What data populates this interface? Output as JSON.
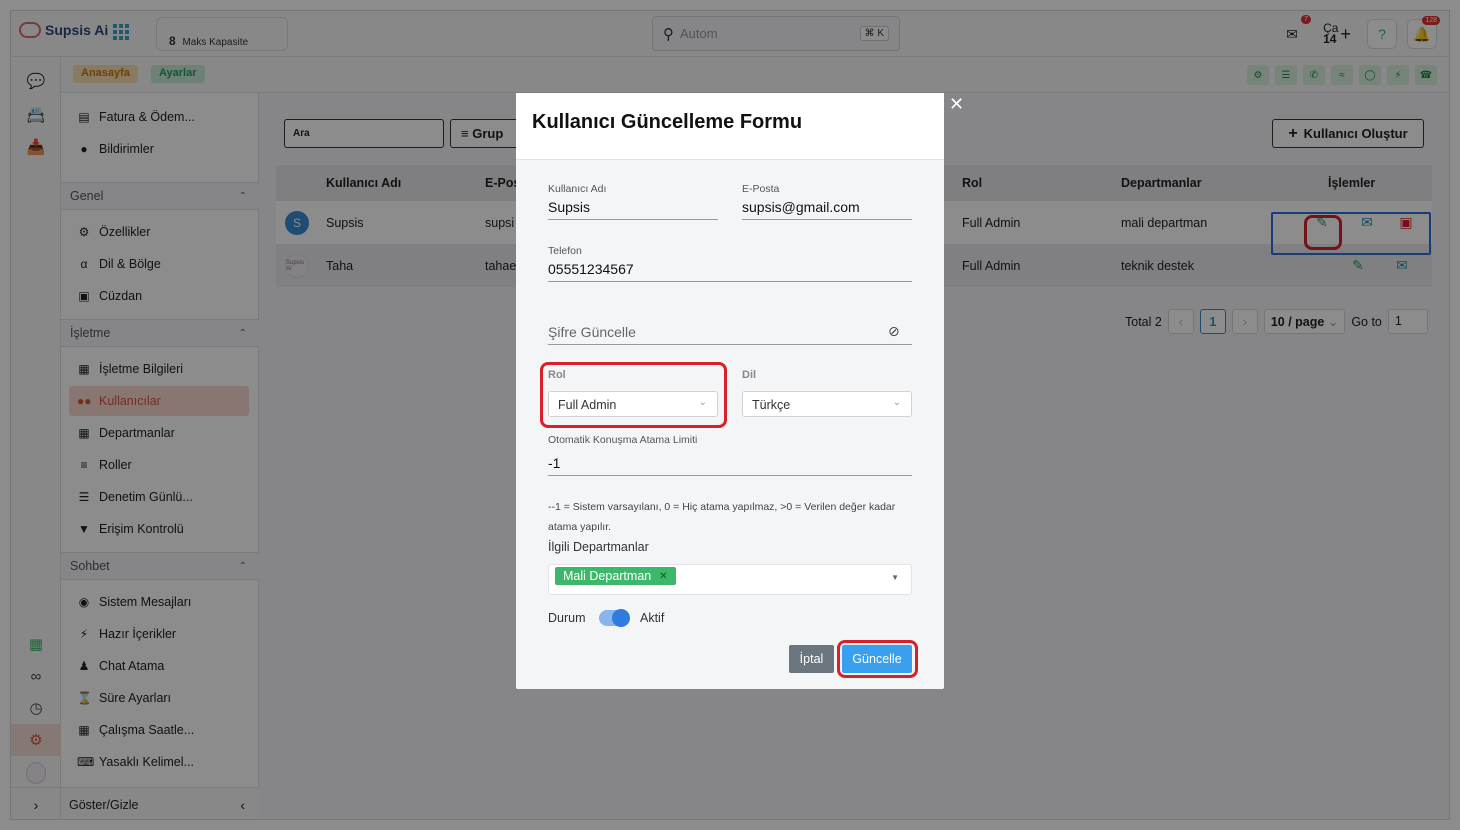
{
  "brand": {
    "name": "Supsis Ai"
  },
  "topbar": {
    "capacity_number": "8",
    "capacity_label": "Maks Kapasite",
    "search_placeholder": "Autom",
    "search_shortcut": "⌘ K",
    "mail_badge": "7",
    "user_initials": "Ça",
    "user_day": "14",
    "notif_badge": "128"
  },
  "breadcrumb": {
    "home": "Anasayfa",
    "settings": "Ayarlar"
  },
  "sidebar": {
    "top_items": [
      {
        "label": "Fatura & Ödem..."
      },
      {
        "label": "Bildirimler"
      }
    ],
    "sections": [
      {
        "title": "Genel",
        "items": [
          {
            "label": "Özellikler"
          },
          {
            "label": "Dil & Bölge"
          },
          {
            "label": "Cüzdan"
          }
        ]
      },
      {
        "title": "İşletme",
        "items": [
          {
            "label": "İşletme Bilgileri"
          },
          {
            "label": "Kullanıcılar"
          },
          {
            "label": "Departmanlar"
          },
          {
            "label": "Roller"
          },
          {
            "label": "Denetim Günlü..."
          },
          {
            "label": "Erişim Kontrolü"
          }
        ]
      },
      {
        "title": "Sohbet",
        "items": [
          {
            "label": "Sistem Mesajları"
          },
          {
            "label": "Hazır İçerikler"
          },
          {
            "label": "Chat Atama"
          },
          {
            "label": "Süre Ayarları"
          },
          {
            "label": "Çalışma Saatle..."
          },
          {
            "label": "Yasaklı Kelimel..."
          }
        ]
      }
    ],
    "footer": "Göster/Gizle"
  },
  "main": {
    "search_placeholder": "Ara",
    "group_label": "Grup",
    "create_label": "Kullanıcı Oluştur",
    "columns": {
      "username": "Kullanıcı Adı",
      "email": "E-Pos",
      "role": "Rol",
      "departments": "Departmanlar",
      "actions": "İşlemler"
    },
    "rows": [
      {
        "avatar": "S",
        "username": "Supsis",
        "email": "supsi",
        "role": "Full Admin",
        "department": "mali departman"
      },
      {
        "avatar": "Supsis AI",
        "username": "Taha",
        "email": "tahae",
        "role": "Full Admin",
        "department": "teknik destek"
      }
    ],
    "pager": {
      "total": "Total 2",
      "page": "1",
      "per_page": "10 / page",
      "goto_label": "Go to",
      "goto_value": "1"
    }
  },
  "modal": {
    "title": "Kullanıcı Güncelleme Formu",
    "username_label": "Kullanıcı Adı",
    "username_value": "Supsis",
    "email_label": "E-Posta",
    "email_value": "supsis@gmail.com",
    "phone_label": "Telefon",
    "phone_value": "05551234567",
    "password_placeholder": "Şifre Güncelle",
    "role_label": "Rol",
    "role_value": "Full Admin",
    "lang_label": "Dil",
    "lang_value": "Türkçe",
    "limit_label": "Otomatik Konuşma Atama Limiti",
    "limit_value": "-1",
    "limit_hint": "--1 = Sistem varsayılanı, 0 = Hiç atama yapılmaz, >0 = Verilen değer kadar atama yapılır.",
    "dept_label": "İlgili Departmanlar",
    "dept_tag": "Mali Departman",
    "status_label": "Durum",
    "status_value": "Aktif",
    "cancel_label": "İptal",
    "update_label": "Güncelle"
  },
  "colors": {
    "accent": "#d2553a",
    "primary_button": "#38a0ec",
    "highlight": "#d8202a",
    "tag": "#3db86a"
  }
}
